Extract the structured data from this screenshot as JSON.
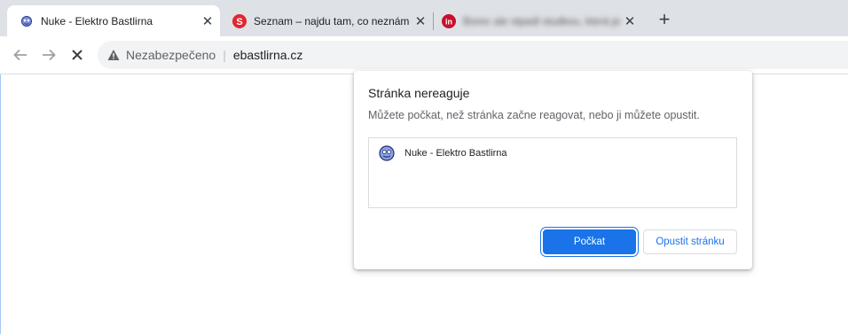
{
  "tabs": [
    {
      "title": "Nuke - Elektro Bastlirna",
      "close": "✕",
      "favicon": "nuke-favicon"
    },
    {
      "title": "Seznam – najdu tam, co neznám",
      "close": "✕",
      "favicon": "seznam-s-icon"
    },
    {
      "title": "Borec ale stpadl studkou, která je",
      "close": "✕",
      "favicon": "innogy-in-icon"
    }
  ],
  "new_tab": "+",
  "address_bar": {
    "security_label": "Nezabezpečeno",
    "divider": "|",
    "url": "ebastlirna.cz"
  },
  "dialog": {
    "title": "Stránka nereaguje",
    "message": "Můžete počkat, než stránka začne reagovat, nebo ji můžete opustit.",
    "pages": [
      {
        "title": "Nuke - Elektro Bastlirna"
      }
    ],
    "wait_label": "Počkat",
    "exit_label": "Opustit stránku"
  },
  "colors": {
    "tabstrip": "#dee1e6",
    "accent": "#1a73e8",
    "seznam_red": "#e1262e",
    "innogy_red": "#c8102e"
  }
}
